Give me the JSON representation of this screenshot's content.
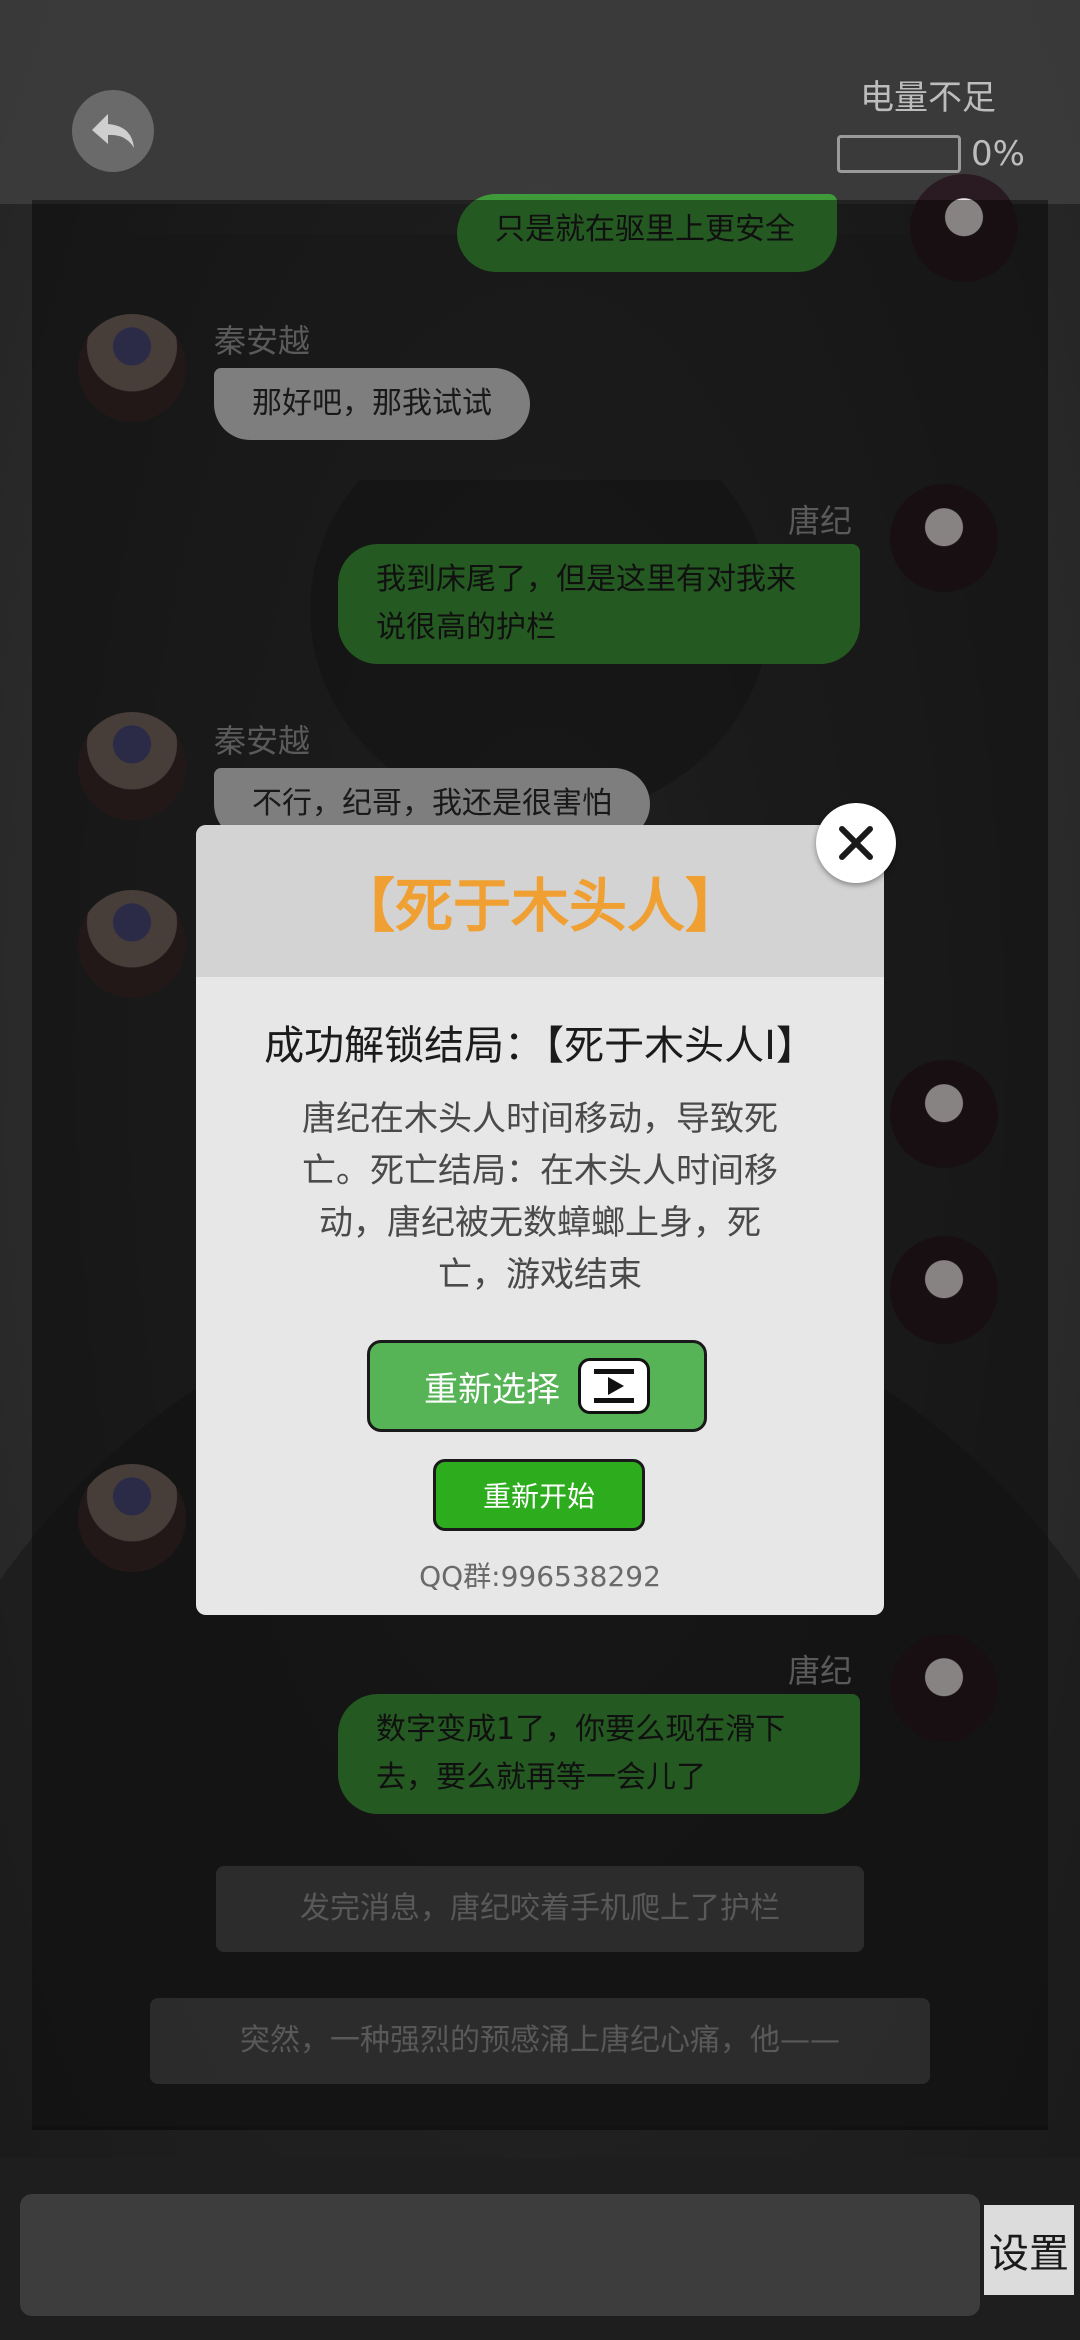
{
  "header": {
    "battery_label": "电量不足",
    "battery_percent_text": "0%",
    "battery_level": 0.0
  },
  "chat": {
    "clipped_message": "只是就在驱里上更安全",
    "messages": [
      {
        "speaker": "秦安越",
        "side": "left",
        "text": "那好吧，那我试试"
      },
      {
        "speaker": "唐纪",
        "side": "right",
        "text": "我到床尾了，但是这里有对我来说很高的护栏"
      },
      {
        "speaker": "秦安越",
        "side": "left",
        "text": "不行，纪哥，我还是很害怕"
      },
      {
        "speaker": "唐纪",
        "side": "right",
        "text": "数字变成1了，你要么现在滑下去，要么就再等一会儿了"
      }
    ],
    "narrations": [
      "发完消息，唐纪咬着手机爬上了护栏",
      "突然，一种强烈的预感涌上唐纪心痛，他——"
    ]
  },
  "dialog": {
    "title": "【死于木头人】",
    "unlock_text": "成功解锁结局：【死于木头人Ⅰ】",
    "description": "唐纪在木头人时间移动，导致死亡。死亡结局：在木头人时间移动，唐纪被无数蟑螂上身，死亡，游戏结束",
    "reselect_label": "重新选择",
    "restart_label": "重新开始",
    "qq_group": "QQ群:996538292",
    "accent_color": "#f0a032"
  },
  "bottom": {
    "settings_label": "设置"
  }
}
